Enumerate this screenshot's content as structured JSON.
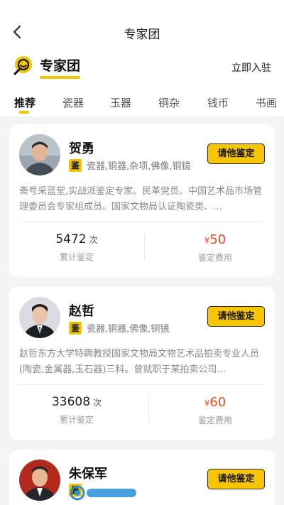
{
  "nav": {
    "title": "专家团"
  },
  "brand": {
    "title": "专家团",
    "join_label": "立即入驻"
  },
  "tabs": [
    {
      "label": "推荐",
      "active": true
    },
    {
      "label": "瓷器",
      "active": false
    },
    {
      "label": "玉器",
      "active": false
    },
    {
      "label": "铜杂",
      "active": false
    },
    {
      "label": "钱币",
      "active": false
    },
    {
      "label": "书画",
      "active": false
    }
  ],
  "experts": [
    {
      "name": "贺勇",
      "badge": "鉴",
      "categories": "瓷器,铜器,杂项,佛像,铜镜",
      "button_label": "请他鉴定",
      "bio": "斋号采蓝堂,实战派鉴定专家。民革党员。中国艺术品市场管理委员会专家组成员。国家文物局认证陶瓷类、…",
      "count_value": "5472",
      "count_unit": "次",
      "count_label": "累计鉴定",
      "price_symbol": "¥",
      "price_value": "50",
      "price_label": "鉴定费用"
    },
    {
      "name": "赵哲",
      "badge": "鉴",
      "categories": "瓷器,铜器,佛像,铜镜",
      "button_label": "请他鉴定",
      "bio": "赵哲东方大学特聘教授国家文物局文物艺术品拍卖专业人员(陶瓷,金属器,玉石器)三科。曾就职于某拍卖公司…",
      "count_value": "33608",
      "count_unit": "次",
      "count_label": "累计鉴定",
      "price_symbol": "¥",
      "price_value": "60",
      "price_label": "鉴定费用"
    },
    {
      "name": "朱保军",
      "badge": "鉴",
      "categories": "",
      "button_label": "请他鉴定"
    }
  ],
  "colors": {
    "accent": "#f5c400",
    "price": "#f04a1e",
    "background": "#f4f4f6"
  },
  "icons": {
    "back": "chevron-left-icon",
    "brand": "search-smile-icon"
  }
}
